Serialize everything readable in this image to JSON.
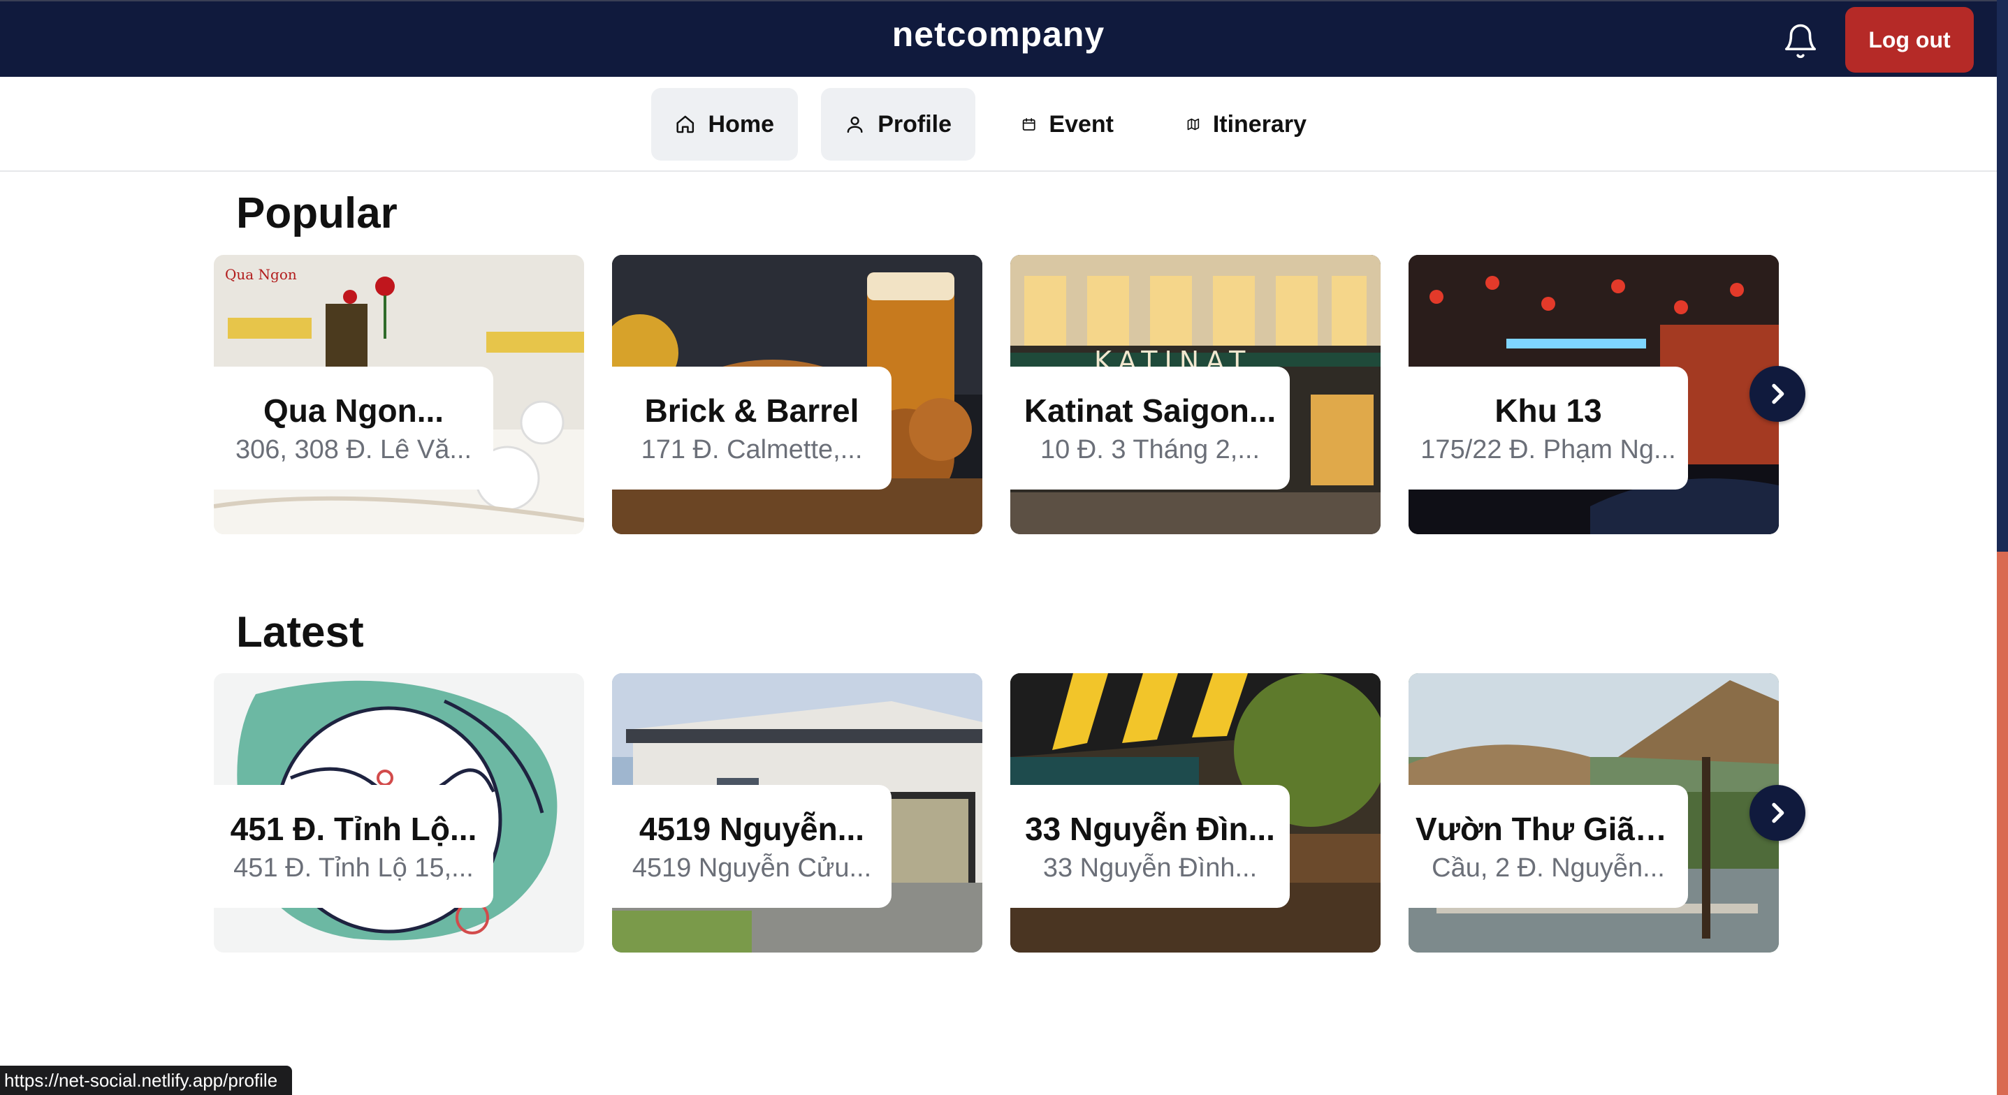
{
  "header": {
    "brand": "netcompany",
    "logout_label": "Log out",
    "bell_icon": "bell-icon",
    "accent": "#101a3d",
    "logout_color": "#b52a27"
  },
  "nav": {
    "items": [
      {
        "label": "Home",
        "icon": "home-icon",
        "active": true
      },
      {
        "label": "Profile",
        "icon": "user-icon",
        "active": true
      },
      {
        "label": "Event",
        "icon": "calendar-icon",
        "active": false
      },
      {
        "label": "Itinerary",
        "icon": "map-icon",
        "active": false
      }
    ]
  },
  "popular": {
    "title": "Popular",
    "cards": [
      {
        "name": "Qua Ngon...",
        "address": "306, 308 Đ. Lê Vă..."
      },
      {
        "name": "Brick & Barrel",
        "address": "171 Đ. Calmette,..."
      },
      {
        "name": "Katinat Saigon...",
        "address": "10 Đ. 3 Tháng 2,..."
      },
      {
        "name": "Khu 13",
        "address": "175/22 Đ. Phạm Ng..."
      }
    ]
  },
  "latest": {
    "title": "Latest",
    "cards": [
      {
        "name": "451 Đ. Tỉnh Lộ...",
        "address": "451 Đ. Tỉnh Lộ 15,..."
      },
      {
        "name": "4519 Nguyễn...",
        "address": "4519 Nguyễn Cửu..."
      },
      {
        "name": "33 Nguyễn Đìn...",
        "address": "33 Nguyễn Đình..."
      },
      {
        "name": "Vườn Thư Giãn...",
        "address": "Cầu, 2 Đ. Nguyễn..."
      }
    ]
  },
  "status_url": "https://net-social.netlify.app/profile"
}
